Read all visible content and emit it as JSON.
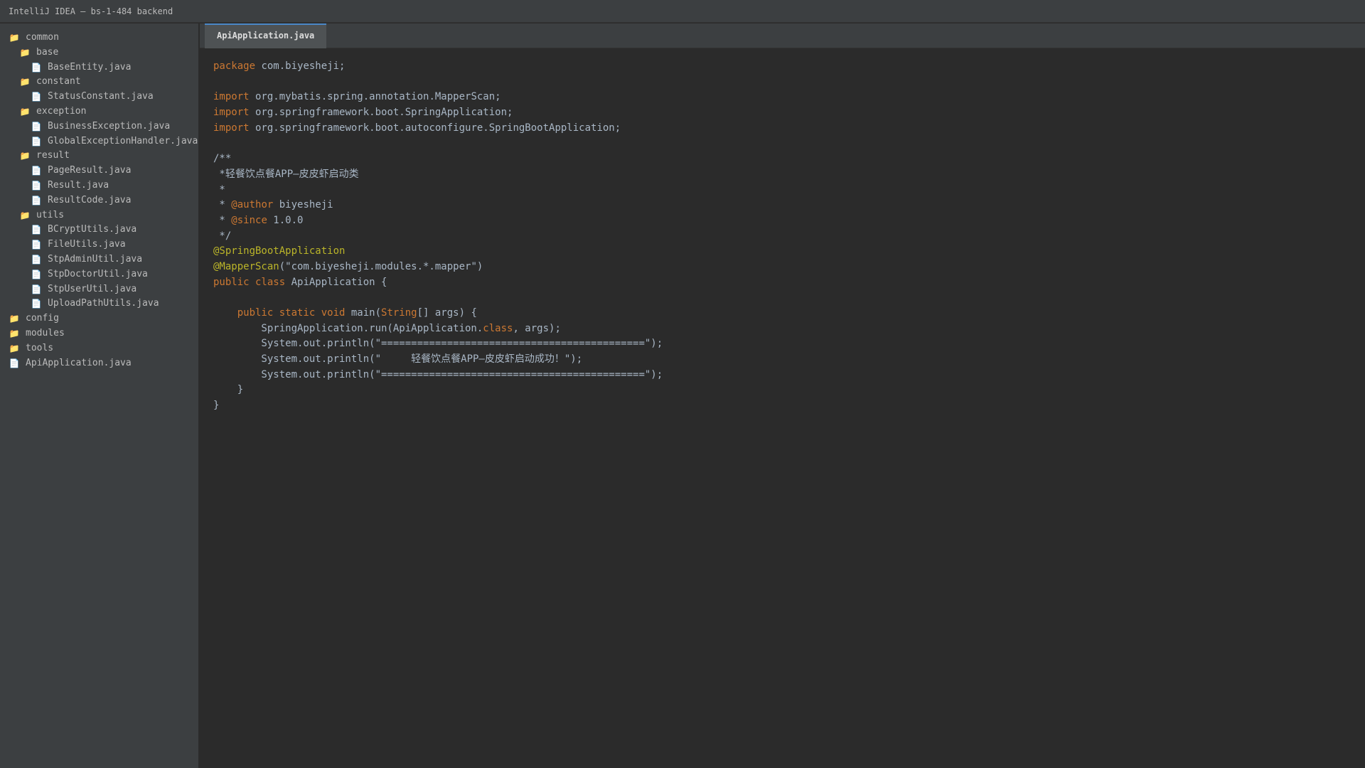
{
  "window": {
    "title": "IntelliJ IDEA — bs-1-484 backend"
  },
  "project_tree": [
    {
      "label": "common",
      "type": "folder",
      "level": 0
    },
    {
      "label": "base",
      "type": "folder",
      "level": 1
    },
    {
      "label": "BaseEntity.java",
      "type": "file",
      "level": 2
    },
    {
      "label": "constant",
      "type": "folder",
      "level": 1
    },
    {
      "label": "StatusConstant.java",
      "type": "file",
      "level": 2
    },
    {
      "label": "exception",
      "type": "folder",
      "level": 1
    },
    {
      "label": "BusinessException.java",
      "type": "file",
      "level": 2
    },
    {
      "label": "GlobalExceptionHandler.java",
      "type": "file",
      "level": 2
    },
    {
      "label": "result",
      "type": "folder",
      "level": 1
    },
    {
      "label": "PageResult.java",
      "type": "file",
      "level": 2
    },
    {
      "label": "Result.java",
      "type": "file",
      "level": 2
    },
    {
      "label": "ResultCode.java",
      "type": "file",
      "level": 2
    },
    {
      "label": "utils",
      "type": "folder",
      "level": 1
    },
    {
      "label": "BCryptUtils.java",
      "type": "file",
      "level": 2
    },
    {
      "label": "FileUtils.java",
      "type": "file",
      "level": 2
    },
    {
      "label": "StpAdminUtil.java",
      "type": "file",
      "level": 2
    },
    {
      "label": "StpDoctorUtil.java",
      "type": "file",
      "level": 2
    },
    {
      "label": "StpUserUtil.java",
      "type": "file",
      "level": 2
    },
    {
      "label": "UploadPathUtils.java",
      "type": "file",
      "level": 2
    },
    {
      "label": "config",
      "type": "folder",
      "level": 0
    },
    {
      "label": "modules",
      "type": "folder",
      "level": 0
    },
    {
      "label": "tools",
      "type": "folder",
      "level": 0
    },
    {
      "label": "ApiApplication.java",
      "type": "file",
      "level": 0
    }
  ],
  "icons": {
    "folder": "folder-icon",
    "file": "file-icon",
    "folder_glyph": "📁",
    "file_glyph": "📄"
  },
  "editor": {
    "active_tab": "ApiApplication.java",
    "lines": [
      [
        {
          "t": "package",
          "c": "kw"
        },
        {
          "t": " com.biyesheji;",
          "c": ""
        }
      ],
      [],
      [
        {
          "t": "import",
          "c": "kw"
        },
        {
          "t": " org.mybatis.spring.annotation.MapperScan;",
          "c": ""
        }
      ],
      [
        {
          "t": "import",
          "c": "kw"
        },
        {
          "t": " org.springframework.boot.SpringApplication;",
          "c": ""
        }
      ],
      [
        {
          "t": "import",
          "c": "kw"
        },
        {
          "t": " org.springframework.boot.autoconfigure.SpringBootApplication;",
          "c": ""
        }
      ],
      [],
      [
        {
          "t": "/**",
          "c": "cmt"
        }
      ],
      [
        {
          "t": " *轻餐饮点餐APP—皮皮虾启动类",
          "c": "cmt"
        }
      ],
      [
        {
          "t": " *",
          "c": "cmt"
        }
      ],
      [
        {
          "t": " * ",
          "c": "cmt"
        },
        {
          "t": "@author",
          "c": "tag"
        },
        {
          "t": " biyesheji",
          "c": "cmt"
        }
      ],
      [
        {
          "t": " * ",
          "c": "cmt"
        },
        {
          "t": "@since",
          "c": "tag"
        },
        {
          "t": " 1.0.0",
          "c": "cmt"
        }
      ],
      [
        {
          "t": " */",
          "c": "cmt"
        }
      ],
      [
        {
          "t": "@SpringBootApplication",
          "c": "ann"
        }
      ],
      [
        {
          "t": "@MapperScan",
          "c": "ann"
        },
        {
          "t": "(\"com.biyesheji.modules.*.mapper\")",
          "c": ""
        }
      ],
      [
        {
          "t": "public class",
          "c": "kw"
        },
        {
          "t": " ApiApplication {",
          "c": ""
        }
      ],
      [],
      [
        {
          "t": "    ",
          "c": ""
        },
        {
          "t": "public static void",
          "c": "kw"
        },
        {
          "t": " main(",
          "c": ""
        },
        {
          "t": "String",
          "c": "kw"
        },
        {
          "t": "[] args) {",
          "c": ""
        }
      ],
      [
        {
          "t": "        SpringApplication.run(ApiApplication.",
          "c": ""
        },
        {
          "t": "class",
          "c": "kw"
        },
        {
          "t": ", args);",
          "c": ""
        }
      ],
      [
        {
          "t": "        System.out.println(\"============================================\");",
          "c": ""
        }
      ],
      [
        {
          "t": "        System.out.println(\"     轻餐饮点餐APP—皮皮虾启动成功！\");",
          "c": ""
        }
      ],
      [
        {
          "t": "        System.out.println(\"============================================\");",
          "c": ""
        }
      ],
      [
        {
          "t": "    }",
          "c": ""
        }
      ],
      [
        {
          "t": "}",
          "c": ""
        }
      ]
    ]
  }
}
